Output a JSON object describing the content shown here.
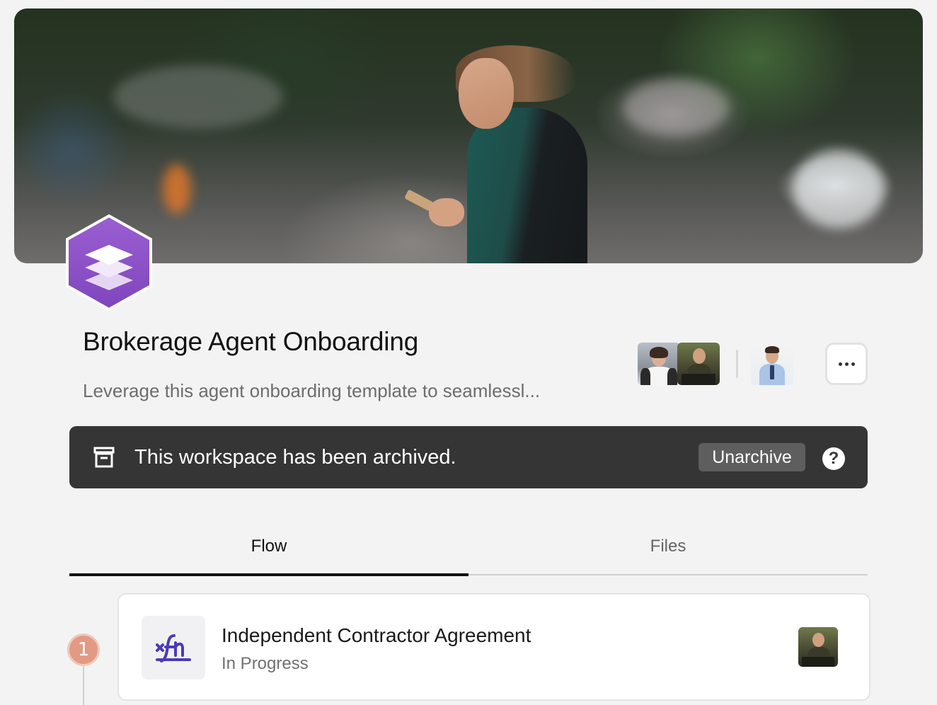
{
  "workspace": {
    "title": "Brokerage Agent Onboarding",
    "description": "Leverage this agent onboarding template to seamlessl..."
  },
  "members": [
    {
      "name": "member-1",
      "icon": "avatar-woman"
    },
    {
      "name": "member-2",
      "icon": "avatar-man-desk"
    },
    {
      "name": "member-3",
      "icon": "avatar-man-crossed-arms"
    }
  ],
  "more_menu": {
    "icon": "more-horizontal-icon"
  },
  "archived_banner": {
    "icon": "archive-box-icon",
    "message": "This workspace has been archived.",
    "unarchive_label": "Unarchive",
    "help_glyph": "?"
  },
  "tabs": [
    {
      "label": "Flow",
      "active": true
    },
    {
      "label": "Files",
      "active": false
    }
  ],
  "flow_steps": [
    {
      "number": "1",
      "title": "Independent Contractor Agreement",
      "status": "In Progress",
      "icon": "signature-icon"
    }
  ],
  "colors": {
    "brand_purple": "#8b4fc6",
    "banner_bg": "#353535",
    "step_badge": "#e29a85",
    "signature_icon": "#4b3bb5"
  }
}
